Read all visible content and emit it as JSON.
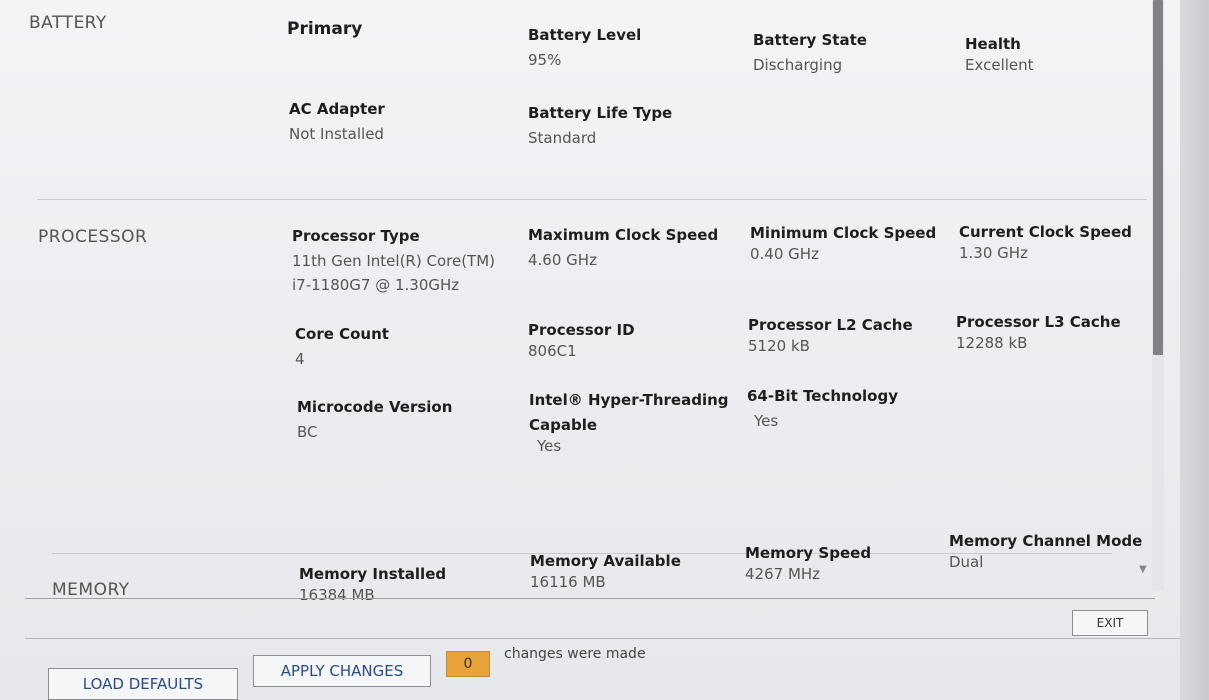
{
  "sections": {
    "battery": "BATTERY",
    "processor": "PROCESSOR",
    "memory": "MEMORY"
  },
  "battery": {
    "primary": "Primary",
    "level_label": "Battery Level",
    "level_value": "95%",
    "state_label": "Battery State",
    "state_value": "Discharging",
    "health_label": "Health",
    "health_value": "Excellent",
    "ac_label": "AC Adapter",
    "ac_value": "Not Installed",
    "life_label": "Battery Life Type",
    "life_value": "Standard"
  },
  "processor": {
    "type_label": "Processor Type",
    "type_value_1": "11th Gen Intel(R) Core(TM)",
    "type_value_2": "i7-1180G7 @ 1.30GHz",
    "max_label": "Maximum Clock Speed",
    "max_value": "4.60 GHz",
    "min_label": "Minimum Clock Speed",
    "min_value": "0.40 GHz",
    "cur_label": "Current Clock Speed",
    "cur_value": "1.30 GHz",
    "cores_label": "Core Count",
    "cores_value": "4",
    "id_label": "Processor ID",
    "id_value": "806C1",
    "l2_label": "Processor L2 Cache",
    "l2_value": "5120 kB",
    "l3_label": "Processor L3 Cache",
    "l3_value": "12288 kB",
    "micro_label": "Microcode Version",
    "micro_value": "BC",
    "ht_label_1": "Intel® Hyper-Threading",
    "ht_label_2": "Capable",
    "ht_value": "Yes",
    "bit64_label": "64-Bit Technology",
    "bit64_value": "Yes"
  },
  "memory": {
    "installed_label": "Memory Installed",
    "installed_value": "16384 MB",
    "available_label": "Memory Available",
    "available_value": "16116 MB",
    "speed_label": "Memory Speed",
    "speed_value": "4267 MHz",
    "channel_label": "Memory Channel Mode",
    "channel_value": "Dual"
  },
  "footer": {
    "exit": "EXIT",
    "load_defaults": "LOAD DEFAULTS",
    "apply_changes": "APPLY CHANGES",
    "changes_count": "0",
    "changes_text": "changes were made"
  }
}
